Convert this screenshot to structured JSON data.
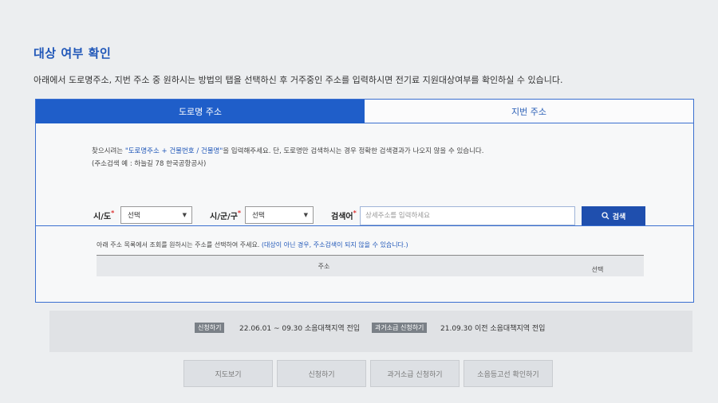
{
  "page": {
    "title": "대상 여부 확인",
    "intro": "아래에서 도로명주소, 지번 주소 중 원하시는 방법의 탭을 선택하신 후 거주중인 주소를 입력하시면 전기료 지원대상여부를 확인하실 수 있습니다."
  },
  "tabs": [
    {
      "label": "도로명 주소",
      "active": true
    },
    {
      "label": "지번 주소",
      "active": false
    }
  ],
  "search": {
    "hint_prefix": "찾으시려는 ",
    "hint_highlight": "\"도로명주소 + 건물번호 / 건물명\"",
    "hint_suffix": "을 입력해주세요. 단, 도로명만 검색하시는 경우 정확한 검색결과가 나오지 않을 수 있습니다.",
    "example": "(주소검색 예 : 하늘길 78 한국공항공사)",
    "sido_label": "시/도",
    "sido_value": "선택",
    "sigungu_label": "시/군/구",
    "sigungu_value": "선택",
    "keyword_label": "검색어",
    "required_mark": "*",
    "keyword_placeholder": "상세주소를 입력하세요",
    "button_label": "검색",
    "button_icon": "search-icon"
  },
  "results": {
    "note": "아래 주소 목록에서 조회를 원하시는 주소를 선택하여 주세요. ",
    "note_highlight": "(대상이 아닌 경우, 주소검색이 되지 않을 수 있습니다.)",
    "columns": [
      "주소",
      "선택"
    ]
  },
  "info": {
    "badge1": "신청하기",
    "text1": "22.06.01 ~ 09.30 소음대책지역 전입",
    "badge2": "과거소급 신청하기",
    "text2": "21.09.30 이전 소음대책지역 전입"
  },
  "buttons": [
    "지도보기",
    "신청하기",
    "과거소급 신청하기",
    "소음등고선 확인하기"
  ],
  "colors": {
    "accent": "#1f5ec9",
    "button": "#1f4fae"
  }
}
